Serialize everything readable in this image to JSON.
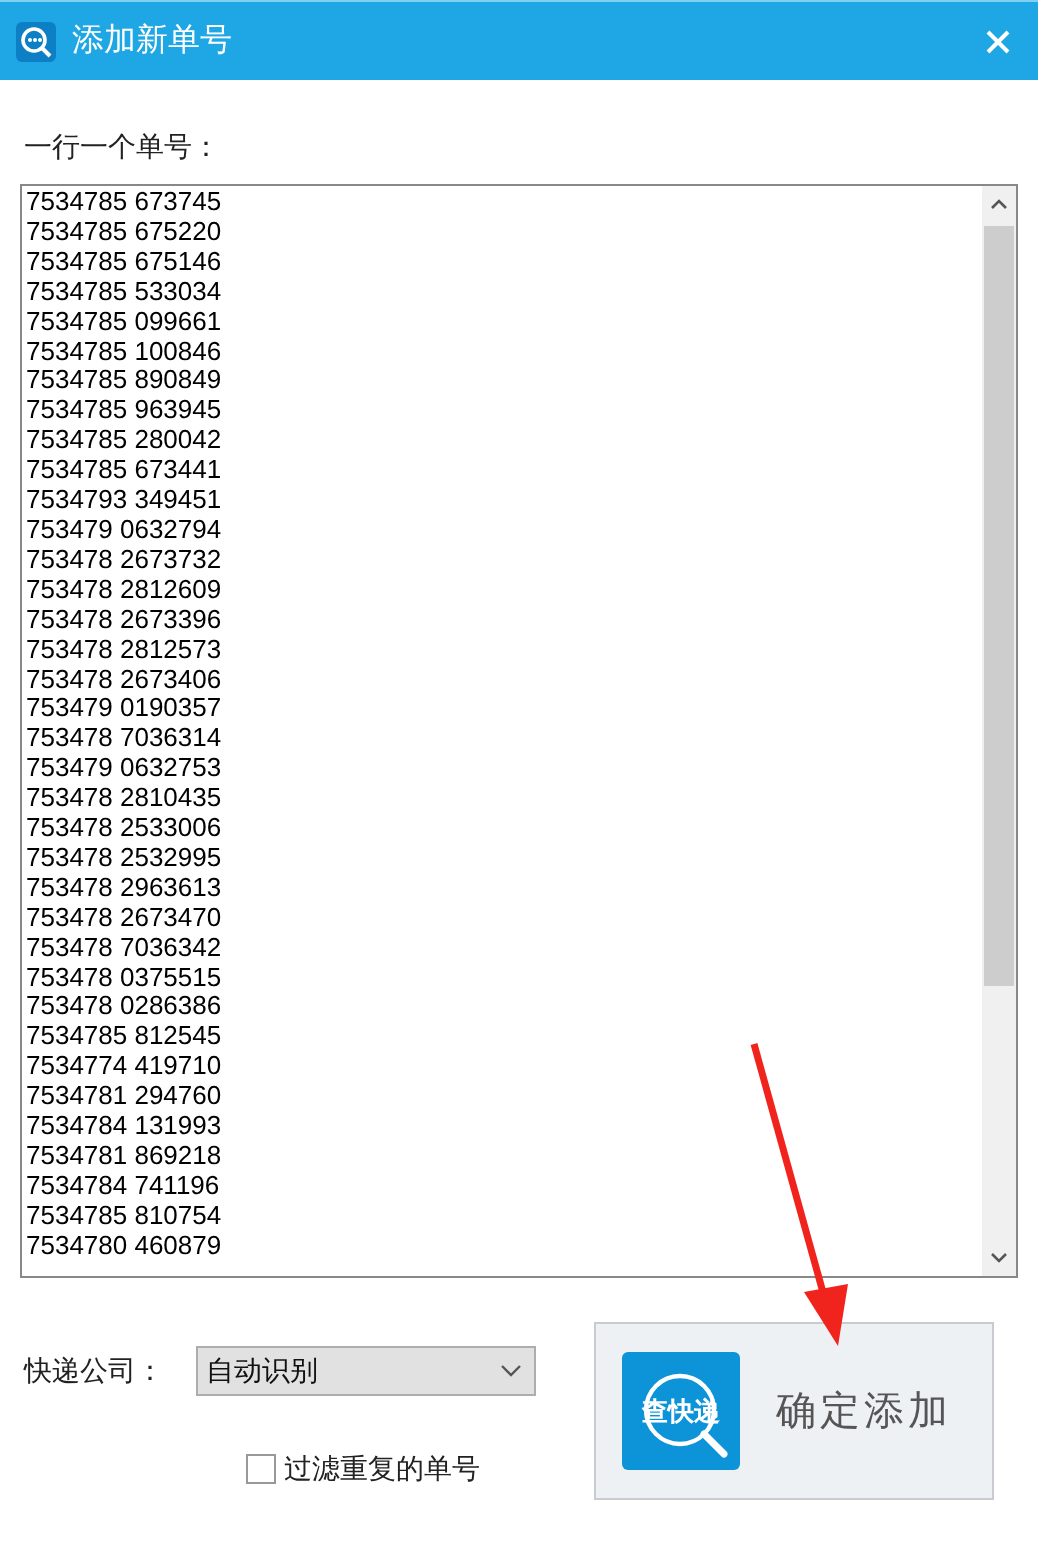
{
  "window": {
    "title": "添加新单号"
  },
  "prompt": "一行一个单号：",
  "tracking_numbers": [
    "7534785 673745",
    "7534785 675220",
    "7534785 675146",
    "7534785 533034",
    "7534785 099661",
    "7534785 100846",
    "7534785 890849",
    "7534785 963945",
    "7534785 280042",
    "7534785 673441",
    "7534793 349451",
    "753479 0632794",
    "753478 2673732",
    "753478 2812609",
    "753478 2673396",
    "753478 2812573",
    "753478 2673406",
    "753479 0190357",
    "753478 7036314",
    "753479 0632753",
    "753478 2810435",
    "753478 2533006",
    "753478 2532995",
    "753478 2963613",
    "753478 2673470",
    "753478 7036342",
    "753478 0375515",
    "753478 0286386",
    "7534785 812545",
    "7534774 419710",
    "7534781 294760",
    "7534784 131993",
    "7534781 869218",
    "7534784 741196",
    "7534785 810754",
    "7534780 460879"
  ],
  "courier": {
    "label": "快递公司：",
    "value": "自动识别"
  },
  "filter_duplicates": {
    "label": "过滤重复的单号",
    "checked": false
  },
  "confirm_button": {
    "icon_text": "查快递",
    "label": "确定添加"
  }
}
